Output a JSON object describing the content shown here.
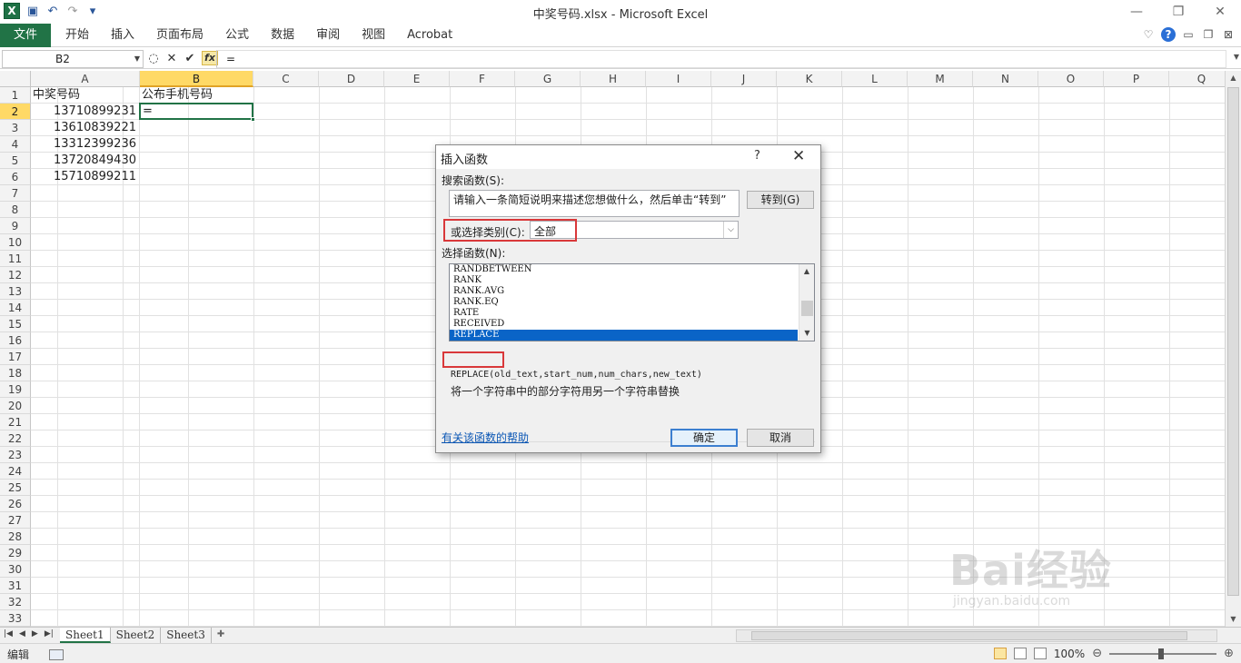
{
  "window": {
    "title": "中奖号码.xlsx - Microsoft Excel",
    "app_icon": "excel-icon",
    "controls": [
      "—",
      "❐",
      "✕"
    ]
  },
  "ribbon": {
    "file_tab": "文件",
    "tabs": [
      "开始",
      "插入",
      "页面布局",
      "公式",
      "数据",
      "审阅",
      "视图",
      "Acrobat"
    ]
  },
  "formula_bar": {
    "name_box": "B2",
    "formula": "="
  },
  "columns": [
    "A",
    "B",
    "C",
    "D",
    "E",
    "F",
    "G",
    "H",
    "I",
    "J",
    "K",
    "L",
    "M",
    "N",
    "O",
    "P",
    "Q"
  ],
  "rows": [
    "1",
    "2",
    "3",
    "4",
    "5",
    "6",
    "7",
    "8",
    "9",
    "10",
    "11",
    "12",
    "13",
    "14",
    "15",
    "16",
    "17",
    "18",
    "19",
    "20",
    "21",
    "22",
    "23",
    "24",
    "25",
    "26",
    "27",
    "28",
    "29",
    "30",
    "31",
    "32",
    "33"
  ],
  "cells": {
    "A1": "中奖号码",
    "B1": "公布手机号码",
    "A2": "13710899231",
    "B2": "=",
    "A3": "13610839221",
    "A4": "13312399236",
    "A5": "13720849430",
    "A6": "15710899211"
  },
  "sheets": [
    "Sheet1",
    "Sheet2",
    "Sheet3"
  ],
  "status": {
    "mode": "编辑",
    "zoom": "100%"
  },
  "dialog": {
    "title": "插入函数",
    "help": "?",
    "search_label": "搜索函数(S):",
    "search_text": "请输入一条简短说明来描述您想做什么，然后单击“转到”",
    "go_button": "转到(G)",
    "category_label": "或选择类别(C):",
    "category_value": "全部",
    "function_label": "选择函数(N):",
    "functions": [
      "RANDBETWEEN",
      "RANK",
      "RANK.AVG",
      "RANK.EQ",
      "RATE",
      "RECEIVED",
      "REPLACE"
    ],
    "selected_function": "REPLACE",
    "syntax": "REPLACE(old_text,start_num,num_chars,new_text)",
    "description": "将一个字符串中的部分字符用另一个字符串替换",
    "help_link": "有关该函数的帮助",
    "ok": "确定",
    "cancel": "取消"
  },
  "watermark": {
    "main": "Bai经验",
    "sub": "jingyan.baidu.com"
  },
  "colors": {
    "excel_green": "#217346",
    "highlight_red": "#d9383a",
    "selection_blue": "#0a64c7",
    "header_selected": "#ffd966"
  }
}
